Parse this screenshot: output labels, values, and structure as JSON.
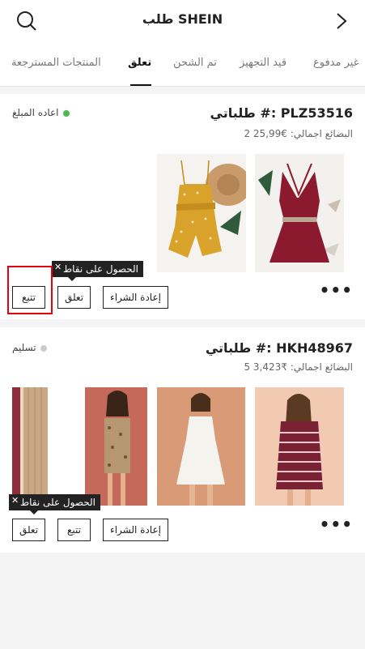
{
  "header": {
    "title": "طلب SHEIN"
  },
  "tabs": [
    {
      "label": "غير مدفوع"
    },
    {
      "label": "قيد التجهيز"
    },
    {
      "label": "تم الشحن"
    },
    {
      "label": "تعلق"
    },
    {
      "label": "المنتجات المسترجعة"
    }
  ],
  "orders": [
    {
      "title": "طلباتي #: PLZ53516",
      "summary": "2 البضائع اجمالي: €25,99",
      "status": "اعاده المبلغ",
      "status_color": "#4cbb4e",
      "actions": {
        "rebuy": "إعادة الشراء",
        "suspend": "تعلق",
        "track": "تتبع"
      },
      "tooltip": "الحصول على نقاط"
    },
    {
      "title": "طلباتي #: HKH48967",
      "summary": "5 البضائع اجمالي: ₹3,423",
      "status": "تسليم",
      "status_color": "#cccccc",
      "actions": {
        "rebuy": "إعادة الشراء",
        "track": "تتبع",
        "suspend": "تعلق"
      },
      "tooltip": "الحصول على نقاط"
    }
  ],
  "icons": {
    "search": "search-icon",
    "back": "chevron-right-icon",
    "more": "more-dots-icon",
    "close": "close-icon"
  }
}
